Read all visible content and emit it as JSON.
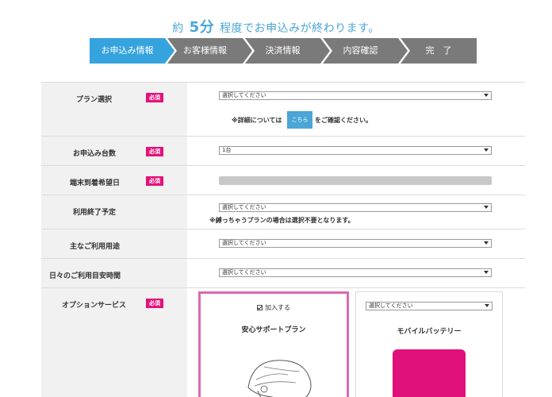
{
  "headline": {
    "pre": "約",
    "minutes": "5分",
    "post": "程度でお申込みが終わります。"
  },
  "steps": [
    {
      "label": "お申込み情報",
      "active": true
    },
    {
      "label": "お客様情報",
      "active": false
    },
    {
      "label": "決済情報",
      "active": false
    },
    {
      "label": "内容確認",
      "active": false
    },
    {
      "label": "完　了",
      "active": false
    }
  ],
  "required_badge": "必須",
  "form": {
    "plan": {
      "label": "プラン選択",
      "value": "選択してください",
      "note_pre": "※詳細については",
      "link": "こちら",
      "note_post": "をご確認ください。"
    },
    "quantity": {
      "label": "お申込み台数",
      "value": "1台"
    },
    "arrival": {
      "label": "端末到着希望日"
    },
    "end_date": {
      "label": "利用終了予定",
      "value": "選択してください",
      "note": "※縛っちゃうプランの場合は選択不要となります。"
    },
    "purpose": {
      "label": "主なご利用用途",
      "value": "選択してください"
    },
    "daily": {
      "label": "日々のご利用目安時間",
      "value": "選択してください"
    },
    "options": {
      "label": "オプションサービス",
      "card1": {
        "check_label": "加入する",
        "checked": true,
        "name": "安心サポートプラン"
      },
      "card2": {
        "select_value": "選択してください",
        "name": "モバイルバッテリー"
      }
    }
  },
  "colors": {
    "accent": "#35a3dd",
    "required": "#e3127b",
    "selected_border": "#d96ab2",
    "battery": "#e0107a"
  }
}
